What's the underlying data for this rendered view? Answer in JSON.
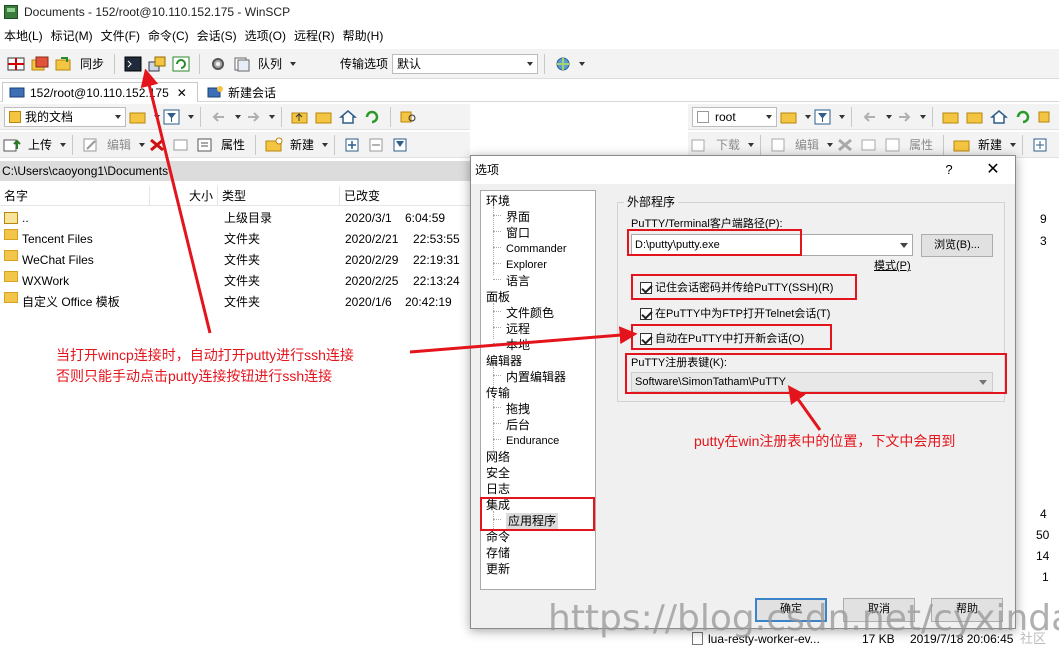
{
  "window": {
    "title": "Documents - 152/root@10.110.152.175 - WinSCP"
  },
  "menu": [
    "本地(L)",
    "标记(M)",
    "文件(F)",
    "命令(C)",
    "会话(S)",
    "选项(O)",
    "远程(R)",
    "帮助(H)"
  ],
  "toolbar": {
    "sync": "同步",
    "queue": "队列",
    "transfer_label": "传输选项",
    "transfer_value": "默认"
  },
  "tabs": {
    "session": "152/root@10.110.152.175",
    "new_session": "新建会话"
  },
  "local": {
    "location": "我的文档",
    "upload": "上传",
    "edit": "编辑",
    "properties": "属性",
    "new": "新建",
    "path": "C:\\Users\\caoyong1\\Documents\\",
    "columns": [
      "名字",
      "大小",
      "类型",
      "已改变"
    ],
    "rows": [
      {
        "name": "..",
        "type": "上级目录",
        "date": "2020/3/1",
        "time": "6:04:59"
      },
      {
        "name": "Tencent Files",
        "type": "文件夹",
        "date": "2020/2/21",
        "time": "22:53:55"
      },
      {
        "name": "WeChat Files",
        "type": "文件夹",
        "date": "2020/2/29",
        "time": "22:19:31"
      },
      {
        "name": "WXWork",
        "type": "文件夹",
        "date": "2020/2/25",
        "time": "22:13:24"
      },
      {
        "name": "自定义 Office 模板",
        "type": "文件夹",
        "date": "2020/1/6",
        "time": "20:42:19"
      }
    ]
  },
  "remote": {
    "location": "root",
    "download": "下载",
    "edit": "编辑",
    "properties": "属性",
    "new": "新建",
    "peek": [
      "9",
      "3",
      "4",
      "50",
      "14",
      "1"
    ],
    "bottom_file": {
      "name": "lua-resty-worker-ev...",
      "size": "17 KB",
      "date": "2019/7/18 20:06:45"
    }
  },
  "dialog": {
    "title": "选项",
    "help": "?",
    "close": "✕",
    "tree": [
      {
        "label": "环境",
        "level": 0
      },
      {
        "label": "界面",
        "level": 1
      },
      {
        "label": "窗口",
        "level": 1
      },
      {
        "label": "Commander",
        "level": 1
      },
      {
        "label": "Explorer",
        "level": 1
      },
      {
        "label": "语言",
        "level": 1
      },
      {
        "label": "面板",
        "level": 0
      },
      {
        "label": "文件颜色",
        "level": 1
      },
      {
        "label": "远程",
        "level": 1
      },
      {
        "label": "本地",
        "level": 1
      },
      {
        "label": "编辑器",
        "level": 0
      },
      {
        "label": "内置编辑器",
        "level": 1
      },
      {
        "label": "传输",
        "level": 0
      },
      {
        "label": "拖拽",
        "level": 1
      },
      {
        "label": "后台",
        "level": 1
      },
      {
        "label": "Endurance",
        "level": 1
      },
      {
        "label": "网络",
        "level": 0
      },
      {
        "label": "安全",
        "level": 0
      },
      {
        "label": "日志",
        "level": 0
      },
      {
        "label": "集成",
        "level": 0
      },
      {
        "label": "应用程序",
        "level": 1,
        "selected": true
      },
      {
        "label": "命令",
        "level": 0
      },
      {
        "label": "存储",
        "level": 0
      },
      {
        "label": "更新",
        "level": 0
      }
    ],
    "group_title": "外部程序",
    "putty_path_label": "PuTTY/Terminal客户端路径(P):",
    "putty_path_value": "D:\\putty\\putty.exe",
    "browse": "浏览(B)...",
    "patterns": "模式(P)",
    "chk_remember_password": "记住会话密码并传给PuTTY(SSH)(R)",
    "chk_telnet_ftp": "在PuTTY中为FTP打开Telnet会话(T)",
    "chk_auto_open": "自动在PuTTY中打开新会话(O)",
    "registry_label": "PuTTY注册表键(K):",
    "registry_value": "Software\\SimonTatham\\PuTTY",
    "ok": "确定",
    "cancel": "取消",
    "help_btn": "帮助"
  },
  "annotations": {
    "note1_line1": "当打开wincp连接时，自动打开putty进行ssh连接",
    "note1_line2": "否则只能手动点击putty连接按钮进行ssh连接",
    "note2": "putty在win注册表中的位置，下文中会用到",
    "color": "#e4141c"
  },
  "watermark": {
    "url": "https://blog.csdn.net/cyxinda",
    "community": "社区"
  }
}
